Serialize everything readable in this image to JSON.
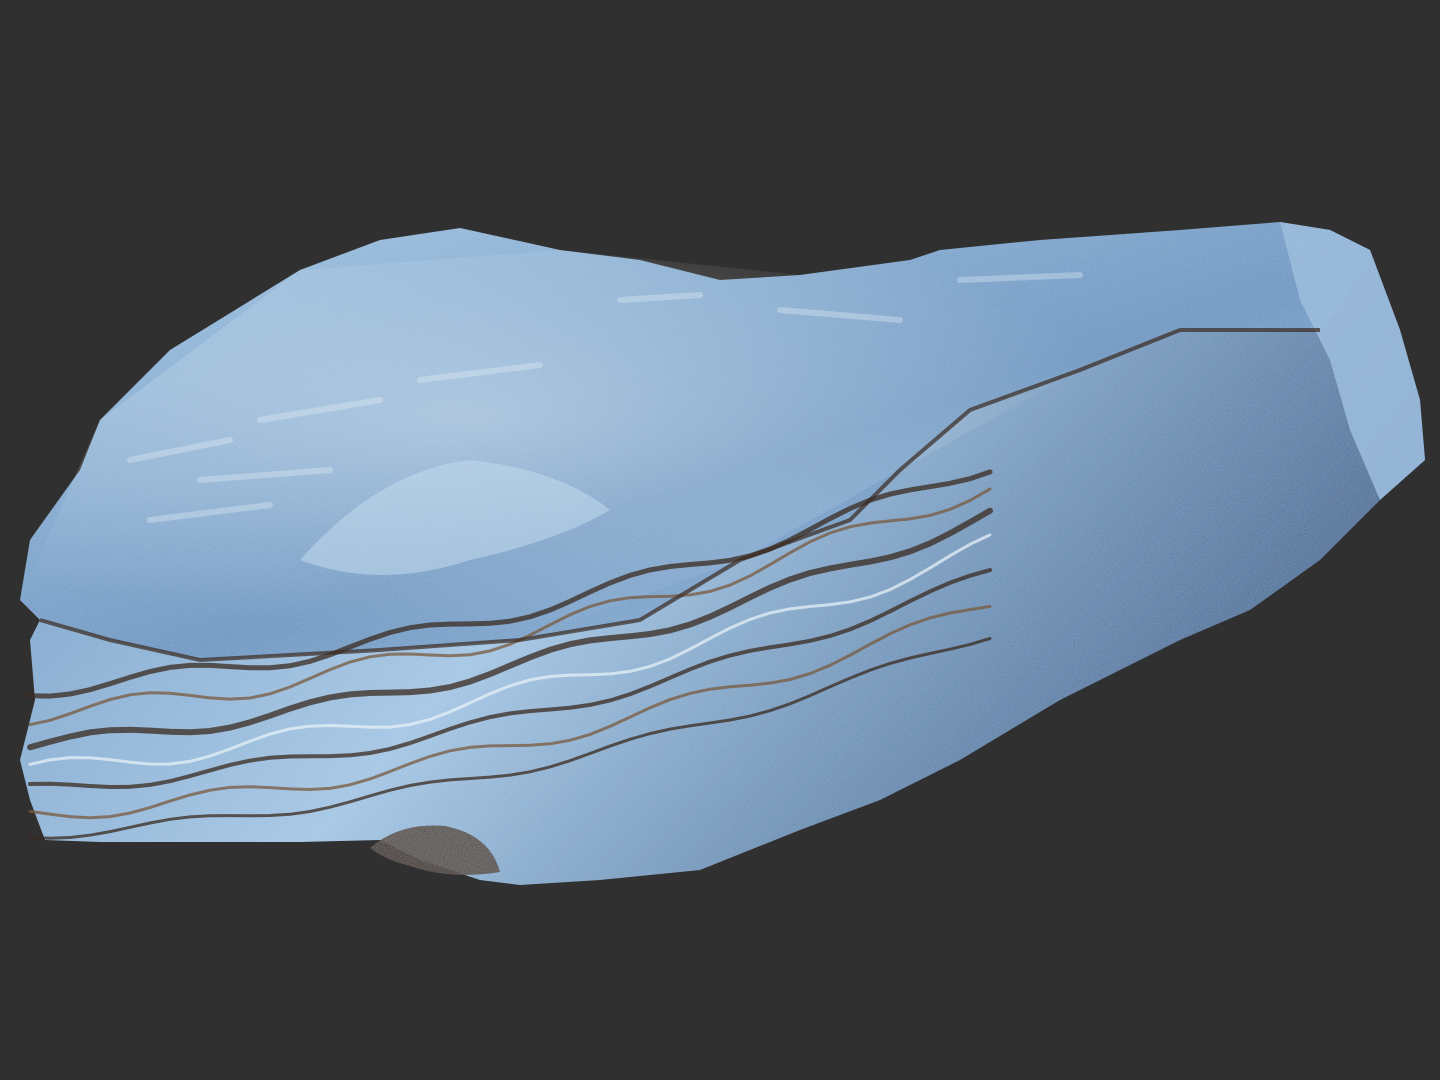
{
  "viewport": {
    "background_color": "#303030"
  },
  "model": {
    "subject": "rock-terrain-mesh",
    "colors": {
      "surface_light": "#9ec3e3",
      "surface_mid": "#5f90bf",
      "surface_dark": "#2f5f8f",
      "highlight": "#e6f0f7",
      "strata_dark": "#3a2a1f",
      "strata_brown": "#7a5a3d"
    }
  }
}
